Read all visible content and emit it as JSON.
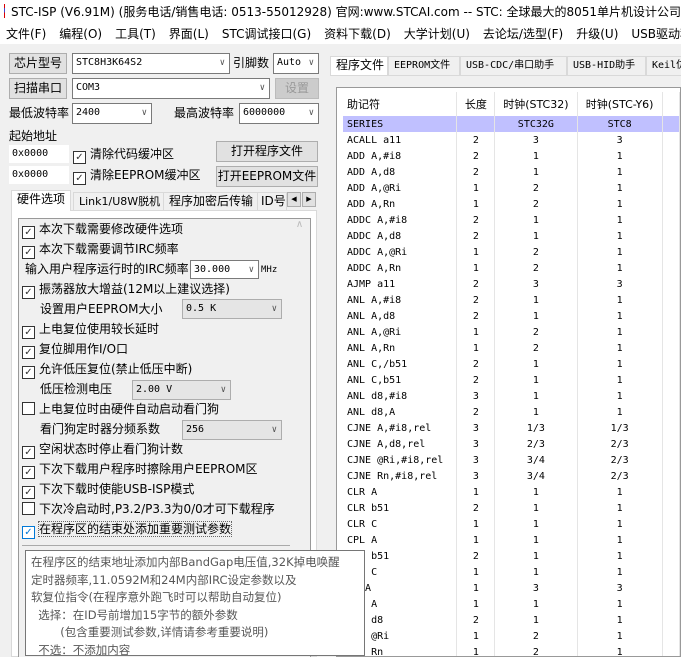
{
  "title": "STC-ISP (V6.91M) (服务电话/销售电话: 0513-55012928) 官网:www.STCAI.com  -- STC: 全球最大的8051单片机设计公司",
  "menu": [
    "文件(F)",
    "编程(O)",
    "工具(T)",
    "界面(L)",
    "STC调试接口(G)",
    "资料下载(D)",
    "大学计划(U)",
    "去论坛/选型(F)",
    "升级(U)",
    "USB驱动程序"
  ],
  "chip": {
    "label": "芯片型号",
    "value": "STC8H3K64S2",
    "pins_label": "引脚数",
    "pins_value": "Auto"
  },
  "port": {
    "label": "扫描串口",
    "value": "COM3",
    "settings": "设置"
  },
  "baud": {
    "min_label": "最低波特率",
    "min_value": "2400",
    "max_label": "最高波特率",
    "max_value": "6000000"
  },
  "address": {
    "label": "起始地址",
    "addr1": "0x0000",
    "clear_code": "清除代码缓冲区",
    "open_program": "打开程序文件",
    "addr2": "0x0000",
    "clear_eeprom": "清除EEPROM缓冲区",
    "open_eeprom": "打开EEPROM文件"
  },
  "left_tabs": [
    "硬件选项",
    "Link1/U8W脱机",
    "程序加密后传输",
    "ID号"
  ],
  "options": {
    "o1": "本次下载需要修改硬件选项",
    "o2": "本次下载需要调节IRC频率",
    "irc_label": "输入用户程序运行时的IRC频率",
    "irc_value": "30.000",
    "irc_unit": "MHz",
    "o3": "振荡器放大增益(12M以上建议选择)",
    "eeprom_label": "设置用户EEPROM大小",
    "eeprom_value": "0.5 K",
    "o4": "上电复位使用较长延时",
    "o5": "复位脚用作I/O口",
    "o6": "允许低压复位(禁止低压中断)",
    "lvd_label": "低压检测电压",
    "lvd_value": "2.00 V",
    "o7": "上电复位时由硬件自动启动看门狗",
    "wdt_label": "看门狗定时器分频系数",
    "wdt_value": "256",
    "o8": "空闲状态时停止看门狗计数",
    "o9": "下次下载用户程序时擦除用户EEPROM区",
    "o10": "下次下载时使能USB-ISP模式",
    "o11": "下次冷启动时,P3.2/P3.3为0/0才可下载程序",
    "o12": "在程序区的结束处添加重要测试参数"
  },
  "tooltip": [
    "在程序区的结束地址添加内部BandGap电压值,32K掉电唤醒",
    "定时器频率,11.0592M和24M内部IRC设定参数以及",
    "软复位指令(在程序意外跑飞时可以帮助自动复位)",
    "  选择：在ID号前增加15字节的额外参数",
    "        (包含重要测试参数,详情请参考重要说明)",
    "  不选：不添加内容"
  ],
  "right_tabs": [
    "程序文件",
    "EEPROM文件",
    "USB-CDC/串口助手",
    "USB-HID助手",
    "Keil仿真"
  ],
  "table": {
    "headers": [
      "助记符",
      "长度",
      "时钟(STC32)",
      "时钟(STC-Y6)"
    ],
    "series": [
      "SERIES",
      "",
      "STC32G",
      "STC8"
    ],
    "rows": [
      [
        "ACALL a11",
        "2",
        "3",
        "3"
      ],
      [
        "ADD A,#i8",
        "2",
        "1",
        "1"
      ],
      [
        "ADD A,d8",
        "2",
        "1",
        "1"
      ],
      [
        "ADD A,@Ri",
        "1",
        "2",
        "1"
      ],
      [
        "ADD A,Rn",
        "1",
        "2",
        "1"
      ],
      [
        "ADDC A,#i8",
        "2",
        "1",
        "1"
      ],
      [
        "ADDC A,d8",
        "2",
        "1",
        "1"
      ],
      [
        "ADDC A,@Ri",
        "1",
        "2",
        "1"
      ],
      [
        "ADDC A,Rn",
        "1",
        "2",
        "1"
      ],
      [
        "AJMP a11",
        "2",
        "3",
        "3"
      ],
      [
        "ANL A,#i8",
        "2",
        "1",
        "1"
      ],
      [
        "ANL A,d8",
        "2",
        "1",
        "1"
      ],
      [
        "ANL A,@Ri",
        "1",
        "2",
        "1"
      ],
      [
        "ANL A,Rn",
        "1",
        "2",
        "1"
      ],
      [
        "ANL C,/b51",
        "2",
        "1",
        "1"
      ],
      [
        "ANL C,b51",
        "2",
        "1",
        "1"
      ],
      [
        "ANL d8,#i8",
        "3",
        "1",
        "1"
      ],
      [
        "ANL d8,A",
        "2",
        "1",
        "1"
      ],
      [
        "CJNE A,#i8,rel",
        "3",
        "1/3",
        "1/3"
      ],
      [
        "CJNE A,d8,rel",
        "3",
        "2/3",
        "2/3"
      ],
      [
        "CJNE @Ri,#i8,rel",
        "3",
        "3/4",
        "2/3"
      ],
      [
        "CJNE Rn,#i8,rel",
        "3",
        "3/4",
        "2/3"
      ],
      [
        "CLR A",
        "1",
        "1",
        "1"
      ],
      [
        "CLR b51",
        "2",
        "1",
        "1"
      ],
      [
        "CLR C",
        "1",
        "1",
        "1"
      ],
      [
        "CPL A",
        "1",
        "1",
        "1"
      ],
      [
        "CPL b51",
        "2",
        "1",
        "1"
      ],
      [
        "CPL C",
        "1",
        "1",
        "1"
      ],
      [
        "DA A",
        "1",
        "3",
        "3"
      ],
      [
        "DEC A",
        "1",
        "1",
        "1"
      ],
      [
        "DEC d8",
        "2",
        "1",
        "1"
      ],
      [
        "DEC @Ri",
        "1",
        "2",
        "1"
      ],
      [
        "DEC Rn",
        "1",
        "2",
        "1"
      ]
    ]
  },
  "colors": {
    "series_bg": "#c0c0ff",
    "check_blue": "#0078d7"
  }
}
